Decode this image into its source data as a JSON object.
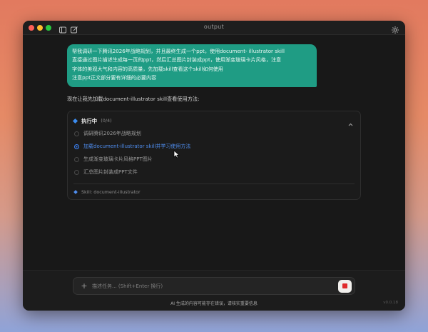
{
  "window": {
    "title": "output"
  },
  "icons": {
    "sidebar": "sidebar-toggle-icon",
    "compose": "compose-icon",
    "settings": "gear-icon",
    "collapse": "chevron-up-icon",
    "add": "plus-icon",
    "stop": "stop-icon",
    "cursor": "mouse-cursor-icon"
  },
  "user_message": {
    "lines": [
      "帮我调研一下腾讯2026年战略规划，并且最终生成一个ppt，使用document- illustrator skill",
      "直接通过图片描述生成每一页的ppt，然后汇总图片封装成ppt，使用渐变玻璃卡片风格，注意",
      "字体的美观大气和内容的高质量，先加载skill查看这个skill如何使用",
      "注意ppt正文部分要有详细的必要内容"
    ]
  },
  "assistant": {
    "intro": "现在让我先加载document-illustrator skill查看使用方法:"
  },
  "task_panel": {
    "title": "执行中",
    "count": "(0/4)",
    "tasks": [
      {
        "label": "调研腾讯2026年战略规划",
        "state": "pending"
      },
      {
        "label": "加载document-illustrator skill并学习使用方法",
        "state": "in_progress"
      },
      {
        "label": "生成渐变玻璃卡片风格PPT图片",
        "state": "pending"
      },
      {
        "label": "汇总图片封装成PPT文件",
        "state": "pending"
      }
    ],
    "skill": "Skill: document-illustrator"
  },
  "composer": {
    "placeholder": "描述任务... (Shift+Enter 换行)",
    "add_label": "+",
    "disclaimer": "AI 生成的内容可能存在错误，请核实重要信息",
    "version": "v0.0.18"
  },
  "colors": {
    "user_bubble": "#1f9c84",
    "accent_blue": "#3b82f6",
    "stop_red": "#e02b2b",
    "window_bg": "#181818"
  }
}
